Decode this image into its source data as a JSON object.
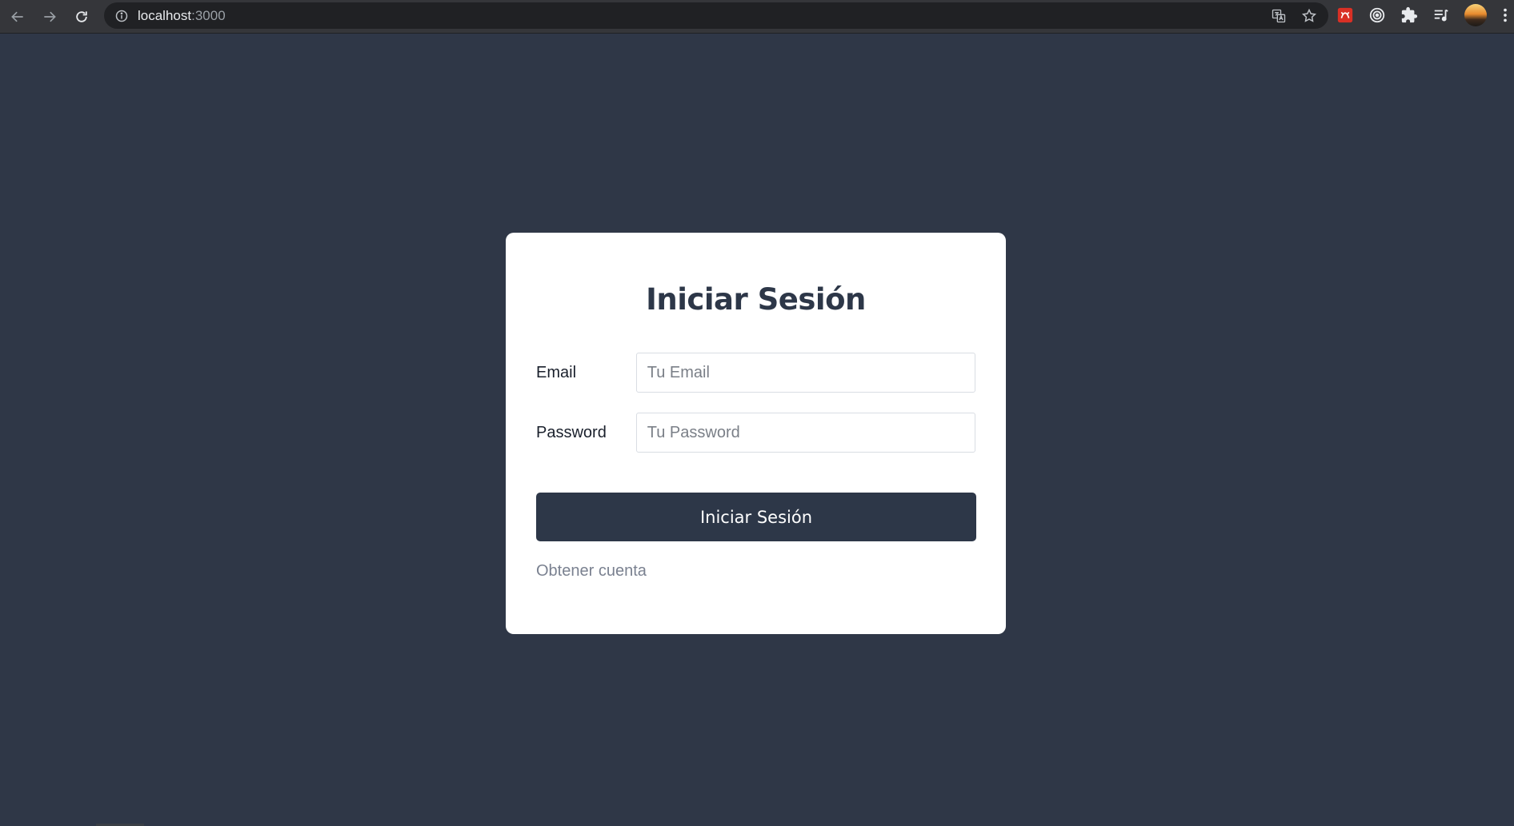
{
  "browser": {
    "url_host": "localhost",
    "url_port": ":3000"
  },
  "login": {
    "title": "Iniciar Sesión",
    "email_label": "Email",
    "email_placeholder": "Tu Email",
    "password_label": "Password",
    "password_placeholder": "Tu Password",
    "submit_label": "Iniciar Sesión",
    "signup_link": "Obtener cuenta"
  },
  "colors": {
    "background": "#2f3747",
    "card": "#ffffff",
    "primary": "#2d3748",
    "link": "#7a8190"
  }
}
